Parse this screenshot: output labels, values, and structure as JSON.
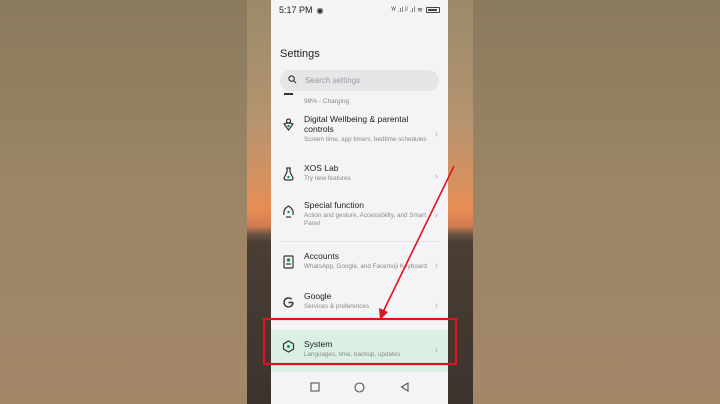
{
  "status": {
    "time": "5:17 PM",
    "signal_text": "ᵂ .ıl ᵝ .ıl ≋",
    "battery_icon": "battery-icon"
  },
  "header": {
    "title": "Settings"
  },
  "search": {
    "placeholder": "Search settings"
  },
  "partial_item": {
    "sub": "98% - Charging"
  },
  "items": [
    {
      "label": "Digital Wellbeing & parental controls",
      "sub": "Screen time, app timers, bedtime schedules",
      "icon": "wellbeing-icon"
    },
    {
      "label": "XOS Lab",
      "sub": "Try new features",
      "icon": "lab-flask-icon"
    },
    {
      "label": "Special function",
      "sub": "Action and gesture, Accessibility, and Smart Panel",
      "icon": "special-function-icon"
    },
    {
      "label": "Accounts",
      "sub": "WhatsApp, Google, and Facemoji Keyboard",
      "icon": "accounts-icon"
    },
    {
      "label": "Google",
      "sub": "Services & preferences",
      "icon": "google-icon"
    },
    {
      "label": "System",
      "sub": "Languages, time, backup, updates",
      "icon": "system-icon"
    }
  ],
  "colors": {
    "accent": "#1f8a4c",
    "annotation": "#e0141e",
    "highlight": "#daf0e2"
  }
}
